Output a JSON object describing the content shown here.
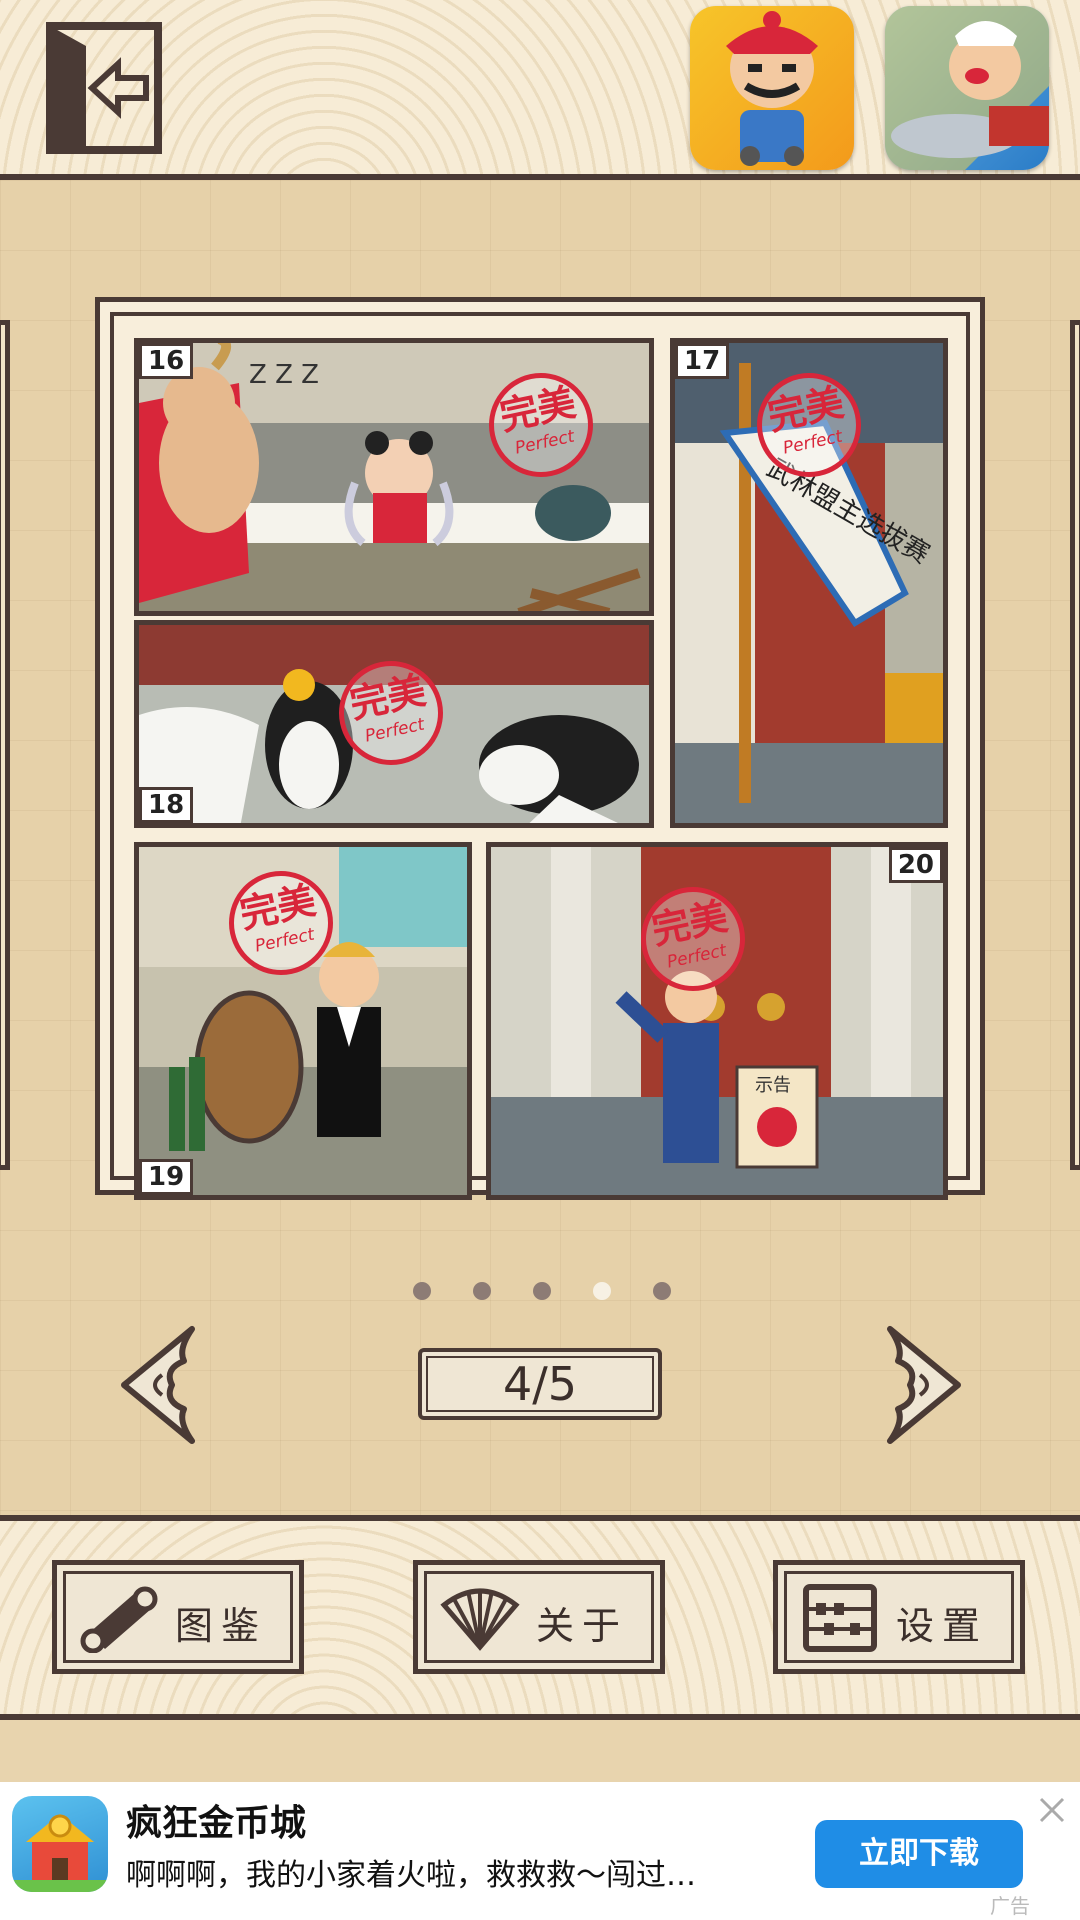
{
  "header": {
    "back_icon": "exit-door-arrow-icon",
    "promo_apps": [
      {
        "icon": "qing-official-character-icon"
      },
      {
        "icon": "chef-wok-character-icon"
      }
    ]
  },
  "gallery": {
    "panels": [
      {
        "number": "16",
        "stamp": "完美",
        "stamp_sub": "Perfect"
      },
      {
        "number": "17",
        "stamp": "完美",
        "stamp_sub": "Perfect",
        "banner_text": "武林盟主选拔赛"
      },
      {
        "number": "18",
        "stamp": "完美",
        "stamp_sub": "Perfect"
      },
      {
        "number": "19",
        "stamp": "完美",
        "stamp_sub": "Perfect"
      },
      {
        "number": "20",
        "stamp": "完美",
        "stamp_sub": "Perfect",
        "notice_text": "示告"
      }
    ],
    "page_dots": 5,
    "active_dot": 4,
    "page_indicator": "4/5"
  },
  "menu": {
    "buttons": [
      {
        "label": "图鉴",
        "icon": "scroll-icon"
      },
      {
        "label": "关于",
        "icon": "fan-icon"
      },
      {
        "label": "设置",
        "icon": "abacus-icon"
      }
    ]
  },
  "ad": {
    "title": "疯狂金币城",
    "description": "啊啊啊，我的小家着火啦，救救救～闯过…",
    "cta": "立即下载",
    "tag": "广告",
    "icon": "coin-city-app-icon"
  },
  "colors": {
    "outline": "#4a3a35",
    "stamp_red": "#d8263a",
    "cta_blue": "#1f8de6"
  }
}
